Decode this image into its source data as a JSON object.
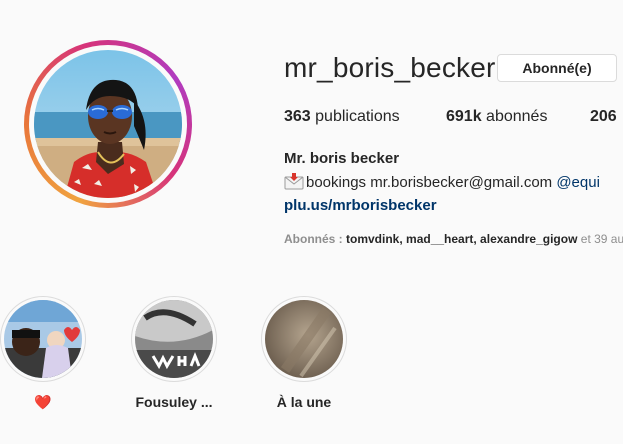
{
  "profile": {
    "username": "mr_boris_becker",
    "follow_button_label": "Abonné(e)",
    "stats": {
      "posts_count": "363",
      "posts_label": "publications",
      "followers_count": "691k",
      "followers_label": "abonnés",
      "following_count": "206"
    },
    "full_name": "Mr. boris becker",
    "bio": {
      "text": "bookings mr.borisbecker@gmail.com",
      "mention": "@equi"
    },
    "website": "plu.us/mrborisbecker",
    "followed_by": {
      "label": "Abonnés :",
      "names": "tomvdink, mad__heart, alexandre_gigow",
      "suffix": "et 39 au"
    }
  },
  "highlights": [
    {
      "label": "❤️",
      "icon": "heart-icon"
    },
    {
      "label": "Fousuley ...",
      "icon": "story-thumbnail"
    },
    {
      "label": "À la une",
      "icon": "story-thumbnail"
    }
  ],
  "colors": {
    "link": "#003569",
    "muted": "#8e8e8e",
    "text": "#262626",
    "ring_start": "#f0a340",
    "ring_end": "#b03bc0"
  }
}
